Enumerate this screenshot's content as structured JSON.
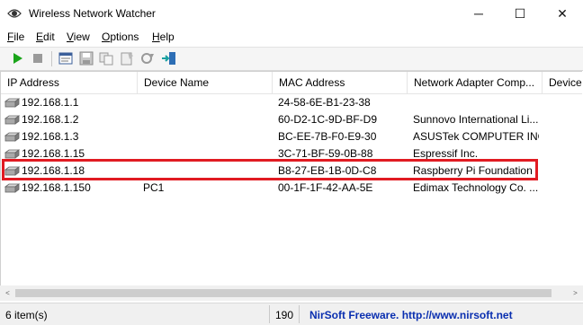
{
  "window": {
    "title": "Wireless Network Watcher",
    "minimize_glyph": "─",
    "maximize_glyph": "☐",
    "close_glyph": "✕"
  },
  "menu": [
    {
      "key": "F",
      "rest": "ile"
    },
    {
      "key": "E",
      "rest": "dit"
    },
    {
      "key": "V",
      "rest": "iew"
    },
    {
      "key": "O",
      "rest": "ptions"
    },
    {
      "key": "H",
      "rest": "elp"
    }
  ],
  "toolbar": {
    "icons": [
      "play-icon",
      "stop-icon",
      "properties-icon",
      "save-icon",
      "copy-icon",
      "html-report-icon",
      "refresh-icon",
      "exit-icon"
    ]
  },
  "table": {
    "columns": [
      "IP Address",
      "Device Name",
      "MAC Address",
      "Network Adapter Comp...",
      "Device"
    ],
    "rows": [
      {
        "ip": "192.168.1.1",
        "device": "",
        "mac": "24-58-6E-B1-23-38",
        "vendor": ""
      },
      {
        "ip": "192.168.1.2",
        "device": "",
        "mac": "60-D2-1C-9D-BF-D9",
        "vendor": "Sunnovo International Li..."
      },
      {
        "ip": "192.168.1.3",
        "device": "",
        "mac": "BC-EE-7B-F0-E9-30",
        "vendor": "ASUSTek COMPUTER INC."
      },
      {
        "ip": "192.168.1.15",
        "device": "",
        "mac": "3C-71-BF-59-0B-88",
        "vendor": "Espressif Inc."
      },
      {
        "ip": "192.168.1.18",
        "device": "",
        "mac": "B8-27-EB-1B-0D-C8",
        "vendor": "Raspberry Pi Foundation"
      },
      {
        "ip": "192.168.1.150",
        "device": "PC1",
        "mac": "00-1F-1F-42-AA-5E",
        "vendor": "Edimax Technology Co. ..."
      }
    ]
  },
  "scrollbar": {
    "left_glyph": "<",
    "right_glyph": ">"
  },
  "status": {
    "items": "6 item(s)",
    "count": "190",
    "credit": "NirSoft Freeware.  http://www.nirsoft.net"
  },
  "colors": {
    "highlight": "#e11b22",
    "play": "#1aa51a"
  }
}
